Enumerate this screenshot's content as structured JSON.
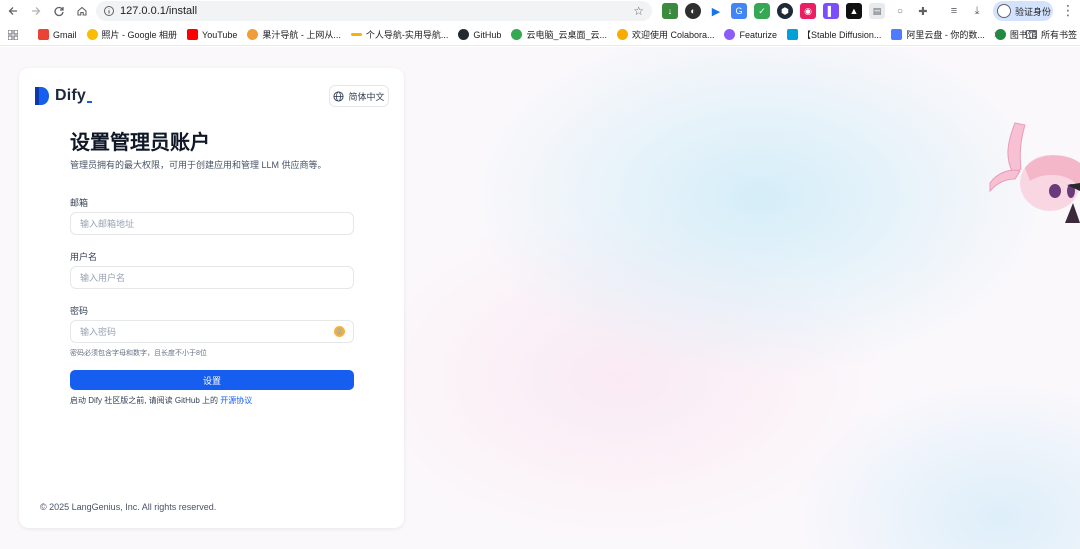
{
  "browser": {
    "url": "127.0.0.1/install",
    "profile_label": "验证身份",
    "bookmarks": [
      {
        "label": "Gmail",
        "color": "#ea4335"
      },
      {
        "label": "照片 - Google 相册",
        "color": "#fbbc04"
      },
      {
        "label": "YouTube",
        "color": "#ff0000"
      },
      {
        "label": "果汁导航 - 上网从...",
        "color": "#f29c38"
      },
      {
        "label": "个人导航-实用导航...",
        "color": "#f4b400"
      },
      {
        "label": "GitHub",
        "color": "#24292f"
      },
      {
        "label": "云电脑_云桌面_云...",
        "color": "#34a853"
      },
      {
        "label": "欢迎使用 Colabora...",
        "color": "#f9ab00"
      },
      {
        "label": "Featurize",
        "color": "#8b5cf6"
      },
      {
        "label": "【Stable Diffusion...",
        "color": "#00a1d6"
      },
      {
        "label": "阿里云盘 - 你的数...",
        "color": "#4f7cff"
      },
      {
        "label": "图书馆",
        "color": "#1e8e3e"
      }
    ],
    "all_bookmarks_label": "所有书签"
  },
  "app": {
    "logo_text": "Dify",
    "language_button": "简体中文",
    "title": "设置管理员账户",
    "subtitle": "管理员拥有的最大权限，可用于创建应用和管理 LLM 供应商等。",
    "email": {
      "label": "邮箱",
      "placeholder": "输入邮箱地址",
      "value": ""
    },
    "username": {
      "label": "用户名",
      "placeholder": "输入用户名",
      "value": ""
    },
    "password": {
      "label": "密码",
      "placeholder": "输入密码",
      "value": "",
      "hint": "密码必须包含字母和数字，且长度不小于8位"
    },
    "submit_label": "设置",
    "agreement_text": "启动 Dify 社区版之前, 请阅读 GitHub 上的",
    "agreement_link": "开源协议",
    "footer": "© 2025 LangGenius, Inc. All rights reserved."
  },
  "colors": {
    "primary": "#155eef",
    "title": "#101828"
  }
}
